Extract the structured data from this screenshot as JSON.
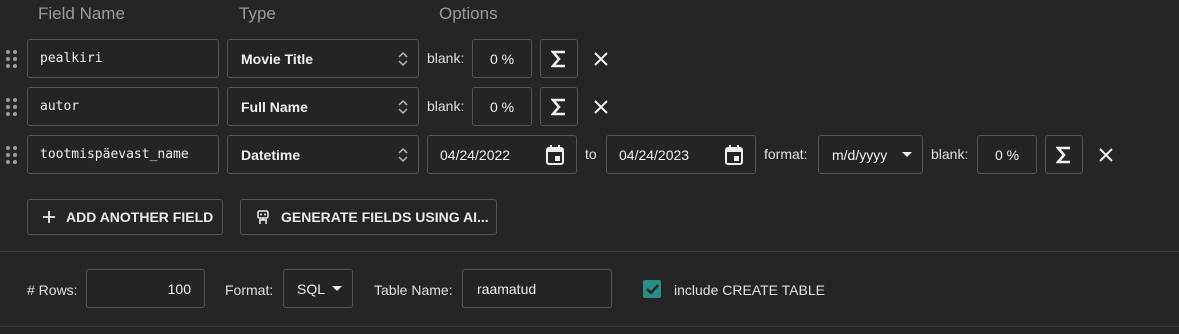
{
  "headers": {
    "field_name": "Field Name",
    "type": "Type",
    "options": "Options"
  },
  "rows": [
    {
      "name": "pealkiri",
      "type": "Movie Title",
      "blank_label": "blank:",
      "blank_value": "0 %"
    },
    {
      "name": "autor",
      "type": "Full Name",
      "blank_label": "blank:",
      "blank_value": "0 %"
    },
    {
      "name": "tootmispäevast_name",
      "type": "Datetime",
      "date_from": "04/24/2022",
      "to_label": "to",
      "date_to": "04/24/2023",
      "format_label": "format:",
      "format_value": "m/d/yyyy",
      "blank_label": "blank:",
      "blank_value": "0 %"
    }
  ],
  "actions": {
    "add_field": "ADD ANOTHER FIELD",
    "generate_ai": "GENERATE FIELDS USING AI..."
  },
  "footer": {
    "rows_label": "# Rows:",
    "rows_value": "100",
    "format_label": "Format:",
    "format_value": "SQL",
    "table_name_label": "Table Name:",
    "table_name_value": "raamatud",
    "include_create_label": "include CREATE TABLE",
    "include_create_checked": true
  },
  "colors": {
    "accent": "#2a8c84",
    "background": "#252525",
    "border": "#555555"
  }
}
